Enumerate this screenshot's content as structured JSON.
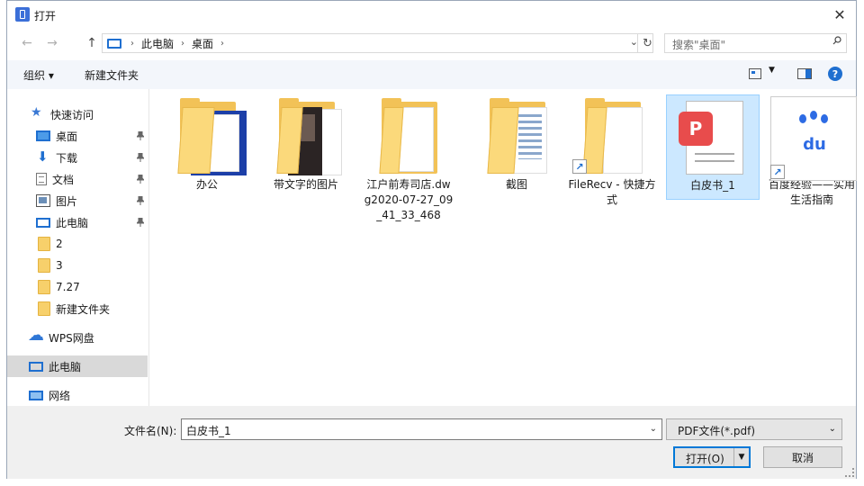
{
  "window": {
    "title": "打开",
    "close_label": "✕"
  },
  "nav": {
    "back": "←",
    "forward": "→",
    "up": "↑",
    "breadcrumb": [
      "此电脑",
      "桌面"
    ],
    "refresh": "↻",
    "search_placeholder": "搜索\"桌面\""
  },
  "toolbar": {
    "organize": "组织 ▾",
    "new_folder": "新建文件夹",
    "help": "?"
  },
  "sidebar": {
    "items": [
      {
        "label": "快速访问",
        "icon": "star-icon"
      },
      {
        "label": "桌面",
        "icon": "desktop-icon",
        "pinned": true
      },
      {
        "label": "下载",
        "icon": "download-icon",
        "pinned": true
      },
      {
        "label": "文档",
        "icon": "document-icon",
        "pinned": true
      },
      {
        "label": "图片",
        "icon": "pictures-icon",
        "pinned": true
      },
      {
        "label": "此电脑",
        "icon": "computer-icon",
        "pinned": true
      },
      {
        "label": "2",
        "icon": "folder-icon"
      },
      {
        "label": "3",
        "icon": "folder-icon"
      },
      {
        "label": "7.27",
        "icon": "folder-icon"
      },
      {
        "label": "新建文件夹",
        "icon": "folder-icon"
      },
      {
        "label": "WPS网盘",
        "icon": "cloud-icon"
      },
      {
        "label": "此电脑",
        "icon": "computer-icon",
        "selected": true
      },
      {
        "label": "网络",
        "icon": "network-icon"
      }
    ]
  },
  "files": [
    {
      "label": "办公",
      "type": "folder"
    },
    {
      "label": "带文字的图片",
      "type": "folder"
    },
    {
      "label": "江户前寿司店.dwg2020-07-27_09_41_33_468",
      "type": "folder"
    },
    {
      "label": "截图",
      "type": "folder"
    },
    {
      "label": "FileRecv - 快捷方式",
      "type": "shortcut"
    },
    {
      "label": "白皮书_1",
      "type": "pdf",
      "selected": true
    },
    {
      "label": "百度经验——实用生活指南",
      "type": "shortcut"
    }
  ],
  "footer": {
    "filename_label": "文件名(N):",
    "filename_value": "白皮书_1",
    "filetype_value": "PDF文件(*.pdf)",
    "open_label": "打开(O)",
    "cancel_label": "取消"
  },
  "colors": {
    "accent": "#0078d7",
    "selection": "#cce8ff",
    "folder": "#fbd97b",
    "pdf_red": "#e84c4c",
    "baidu_blue": "#2d6be4"
  }
}
